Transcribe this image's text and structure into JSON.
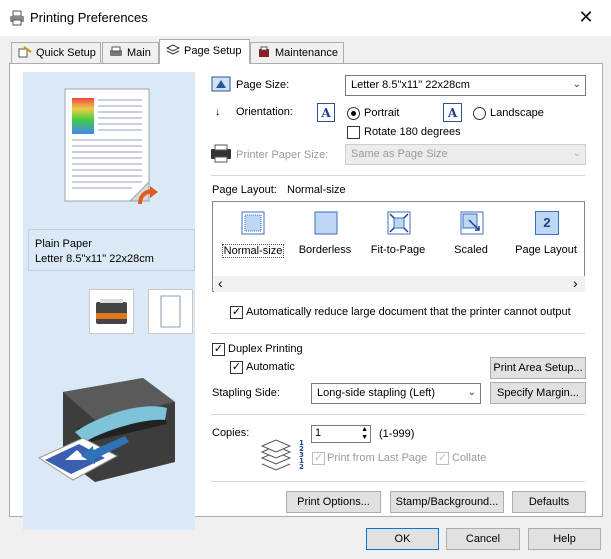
{
  "window": {
    "title": "Printing Preferences",
    "close_glyph": "✕"
  },
  "tabs": [
    {
      "label": "Quick Setup"
    },
    {
      "label": "Main"
    },
    {
      "label": "Page Setup"
    },
    {
      "label": "Maintenance"
    }
  ],
  "preview": {
    "media_type": "Plain Paper",
    "paper_size": "Letter 8.5\"x11\" 22x28cm"
  },
  "page_size": {
    "label": "Page Size:",
    "value": "Letter 8.5\"x11\" 22x28cm"
  },
  "orientation": {
    "label": "Orientation:",
    "portrait_label": "Portrait",
    "landscape_label": "Landscape",
    "selected": "Portrait",
    "rotate_label": "Rotate 180 degrees",
    "rotate_checked": false,
    "icon_letter": "A"
  },
  "printer_paper_size": {
    "label": "Printer Paper Size:",
    "value": "Same as Page Size",
    "enabled": false
  },
  "page_layout": {
    "label": "Page Layout:",
    "current": "Normal-size",
    "options": [
      "Normal-size",
      "Borderless",
      "Fit-to-Page",
      "Scaled",
      "Page Layout"
    ],
    "page_layout_number": "2",
    "scroll_left": "‹",
    "scroll_right": "›"
  },
  "auto_reduce": {
    "label": "Automatically reduce large document that the printer cannot output",
    "checked": true
  },
  "duplex": {
    "label": "Duplex Printing",
    "checked": true,
    "automatic_label": "Automatic",
    "automatic_checked": true,
    "print_area_button": "Print Area Setup..."
  },
  "stapling": {
    "label": "Stapling Side:",
    "value": "Long-side stapling (Left)",
    "specify_margin_button": "Specify Margin..."
  },
  "copies": {
    "label": "Copies:",
    "value": "1",
    "range": "(1-999)",
    "print_from_last_label": "Print from Last Page",
    "print_from_last_checked": true,
    "collate_label": "Collate",
    "collate_checked": true,
    "enabled_options": false
  },
  "buttons": {
    "print_options": "Print Options...",
    "stamp_background": "Stamp/Background...",
    "defaults": "Defaults",
    "ok": "OK",
    "cancel": "Cancel",
    "help": "Help"
  },
  "glyphs": {
    "check": "✓",
    "dropdown": "⌄",
    "spin_up": "▲",
    "spin_down": "▼",
    "down_arrow": "↓"
  },
  "colors": {
    "preview_bg": "#dbe9f6",
    "accent": "#0078d7"
  }
}
